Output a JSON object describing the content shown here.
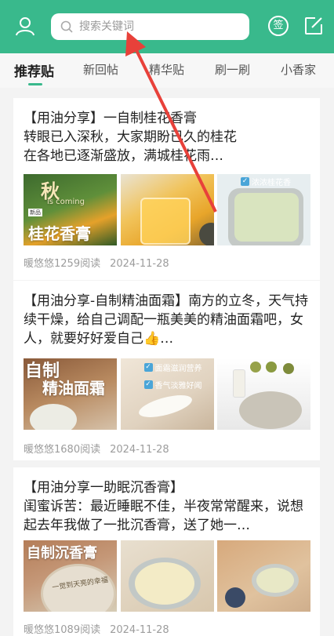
{
  "search": {
    "placeholder": "搜索关键词"
  },
  "topbar_icons": {
    "left": "user-icon",
    "sign": "签",
    "right": "edit-icon"
  },
  "tabs": [
    {
      "label": "推荐贴",
      "active": true
    },
    {
      "label": "新回帖",
      "active": false
    },
    {
      "label": "精华贴",
      "active": false
    },
    {
      "label": "刷一刷",
      "active": false
    },
    {
      "label": "小香家",
      "active": false
    }
  ],
  "posts": [
    {
      "text": "【用油分享】一自制桂花香膏\n转眼已入深秋，大家期盼已久的桂花\n在各地已逐渐盛放，满城桂花雨…",
      "author": "暖悠悠",
      "reads": "1259阅读",
      "date": "2024-11-28",
      "thumb_captions": [
        "is coming",
        "桂花香膏",
        "秋",
        "新品",
        "浓浓桂花香"
      ]
    },
    {
      "text": "【用油分享-自制精油面霜】南方的立冬，天气持续干燥，给自己调配一瓶美美的精油面霜吧，女人，就要好好爱自己👍…",
      "author": "暖悠悠",
      "reads": "1680阅读",
      "date": "2024-11-28",
      "thumb_captions": [
        "自制",
        "精油面霜",
        "面霜滋润营养",
        "香气淡雅好闻"
      ]
    },
    {
      "text": "【用油分享一助眠沉香膏】\n闺蜜诉苦：最近睡眠不佳，半夜常常醒来，说想起去年我做了一批沉香膏，送了她一…",
      "author": "暖悠悠",
      "reads": "1089阅读",
      "date": "2024-11-28",
      "thumb_captions": [
        "自制沉香膏",
        "一觉到天亮的幸福"
      ]
    }
  ],
  "colors": {
    "accent": "#39b98c",
    "annotation_arrow": "#e8413a"
  }
}
